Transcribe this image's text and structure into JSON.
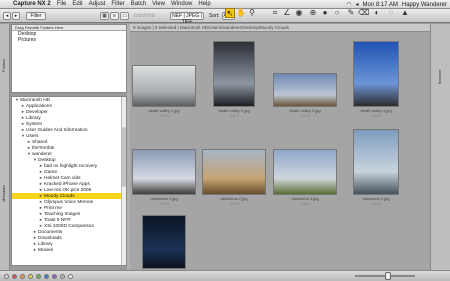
{
  "menubar": {
    "app": "Capture NX 2",
    "menus": [
      "File",
      "Edit",
      "Adjust",
      "Filter",
      "Batch",
      "View",
      "Window",
      "Help"
    ],
    "clock": "Mon 8:17 AM",
    "user": "Happy Wanderer"
  },
  "toolbar": {
    "filter_label": "Filter",
    "filter_stars": "☆☆☆☆☆",
    "format_value": "NEF | JPEG | TIFF",
    "sort_label": "Sort:",
    "sort_value": "ASC"
  },
  "left_tabs": {
    "folders": "Folders",
    "metadata": "Metadata"
  },
  "favorites": {
    "header": "Drag Favorite Folders Here",
    "items": [
      "Desktop",
      "Pictures"
    ]
  },
  "tree": [
    {
      "label": "Macintosh HD",
      "indent": 0,
      "tri": "▼"
    },
    {
      "label": "Applications",
      "indent": 1,
      "tri": "►"
    },
    {
      "label": "Developer",
      "indent": 1,
      "tri": "►"
    },
    {
      "label": "Library",
      "indent": 1,
      "tri": "►"
    },
    {
      "label": "System",
      "indent": 1,
      "tri": "►"
    },
    {
      "label": "User Guides And Information",
      "indent": 1,
      "tri": "►"
    },
    {
      "label": "Users",
      "indent": 1,
      "tri": "▼"
    },
    {
      "label": "Shared",
      "indent": 2,
      "tri": "►"
    },
    {
      "label": "theTerrible",
      "indent": 2,
      "tri": "►"
    },
    {
      "label": "wanderer",
      "indent": 2,
      "tri": "▼"
    },
    {
      "label": "Desktop",
      "indent": 3,
      "tri": "▼"
    },
    {
      "label": "bad nx highlight recovery",
      "indent": 4,
      "tri": "►"
    },
    {
      "label": "Game",
      "indent": 4,
      "tri": "►"
    },
    {
      "label": "Helmet Cam vids",
      "indent": 4,
      "tri": "►"
    },
    {
      "label": "Kracked iPhone Apps",
      "indent": 4,
      "tri": "►"
    },
    {
      "label": "Low-res OK pics 2008",
      "indent": 4,
      "tri": "►"
    },
    {
      "label": "Moody Clouds",
      "indent": 4,
      "tri": "►",
      "selected": true
    },
    {
      "label": "Olympus Voice Memos",
      "indent": 4,
      "tri": "►"
    },
    {
      "label": "Print me",
      "indent": 4,
      "tri": "►"
    },
    {
      "label": "Teaching Images",
      "indent": 4,
      "tri": "►"
    },
    {
      "label": "Toast 9 NFR",
      "indent": 4,
      "tri": "►"
    },
    {
      "label": "XSi 1000D Comparison",
      "indent": 4,
      "tri": "►"
    },
    {
      "label": "Documents",
      "indent": 3,
      "tri": "►"
    },
    {
      "label": "Downloads",
      "indent": 3,
      "tri": "►"
    },
    {
      "label": "Library",
      "indent": 3,
      "tri": "►"
    },
    {
      "label": "Movies",
      "indent": 3,
      "tri": "►"
    }
  ],
  "browser": {
    "path_text": "9 images | 0 Selected | Macintosh HD/Users/wanderer/Desktop/Moody Clouds",
    "stars": "☆☆☆",
    "thumbs": [
      {
        "caption": "death valley 1.jpg",
        "colors": [
          "#dcdedf",
          "#a9aeb2",
          "#5b5e60"
        ]
      },
      {
        "caption": "death valley 2.jpg",
        "colors": [
          "#2b2f36",
          "#8d96a2",
          "#1d1f22"
        ]
      },
      {
        "caption": "death valley 3.jpg",
        "colors": [
          "#6f87b3",
          "#bcc6d4",
          "#6b5535"
        ]
      },
      {
        "caption": "death valley 4.jpg",
        "colors": [
          "#1f54b4",
          "#6b95d6",
          "#2d2d2d"
        ]
      },
      {
        "caption": "oklahoma 1.jpg",
        "colors": [
          "#8b9ab5",
          "#d6dbe4",
          "#3f3c39"
        ]
      },
      {
        "caption": "oklahoma 2.jpg",
        "colors": [
          "#a7b6c8",
          "#c6a371",
          "#6a4d2d"
        ]
      },
      {
        "caption": "oklahoma 3.jpg",
        "colors": [
          "#8fa8c8",
          "#cfd6dc",
          "#5a6d34"
        ]
      },
      {
        "caption": "oklahoma 4.jpg",
        "colors": [
          "#7e9cbf",
          "#c9d3dc",
          "#46525a"
        ]
      },
      {
        "caption": "oklahoma 5.jpg",
        "colors": [
          "#0a1526",
          "#1b3154",
          "#0b1420"
        ]
      }
    ]
  },
  "right_tabs": {
    "browser": "Browser"
  },
  "status": {
    "label_colors": [
      "#d9d9d9",
      "#e34d4d",
      "#f19a38",
      "#e8d63a",
      "#5fbf47",
      "#3c7fe0",
      "#9b59d0",
      "#bbbbbb",
      "#f0f0f0"
    ]
  }
}
